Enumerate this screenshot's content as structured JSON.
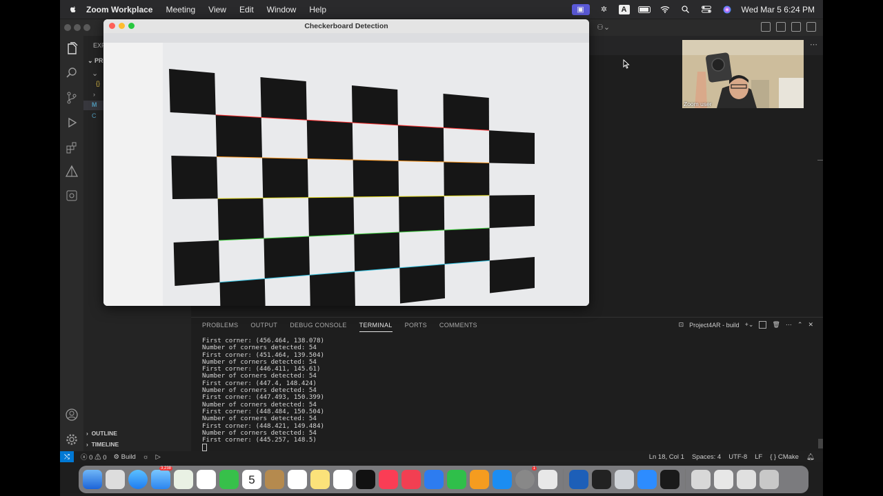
{
  "menubar": {
    "app_name": "Zoom Workplace",
    "items": [
      "Meeting",
      "View",
      "Edit",
      "Window",
      "Help"
    ],
    "clock": "Wed Mar 5  6:24 PM"
  },
  "checkerboard_window": {
    "title": "Checkerboard Detection"
  },
  "zoom_self_view": {
    "label": "Zoom user"
  },
  "sidebar": {
    "explorer_label": "EXPL",
    "project_label": "PROJ",
    "outline_label": "OUTLINE",
    "timeline_label": "TIMELINE"
  },
  "panel": {
    "tabs": [
      "PROBLEMS",
      "OUTPUT",
      "DEBUG CONSOLE",
      "TERMINAL",
      "PORTS",
      "COMMENTS"
    ],
    "active_tab": "TERMINAL",
    "terminal_name": "Project4AR - build",
    "terminal_lines": [
      "First corner: (456.464, 138.078)",
      "Number of corners detected: 54",
      "First corner: (451.464, 139.504)",
      "Number of corners detected: 54",
      "First corner: (446.411, 145.61)",
      "Number of corners detected: 54",
      "First corner: (447.4, 148.424)",
      "Number of corners detected: 54",
      "First corner: (447.493, 150.399)",
      "Number of corners detected: 54",
      "First corner: (448.484, 150.504)",
      "Number of corners detected: 54",
      "First corner: (448.421, 149.484)",
      "Number of corners detected: 54",
      "First corner: (445.257, 148.5)"
    ]
  },
  "statusbar": {
    "errors": "0",
    "warnings": "0",
    "build_label": "Build",
    "position": "Ln 18, Col 1",
    "spaces": "Spaces: 4",
    "encoding": "UTF-8",
    "eol": "LF",
    "language": "CMake"
  },
  "dock": {
    "mail_badge": "3,238",
    "calendar_day": "5",
    "settings_badge": "1"
  }
}
